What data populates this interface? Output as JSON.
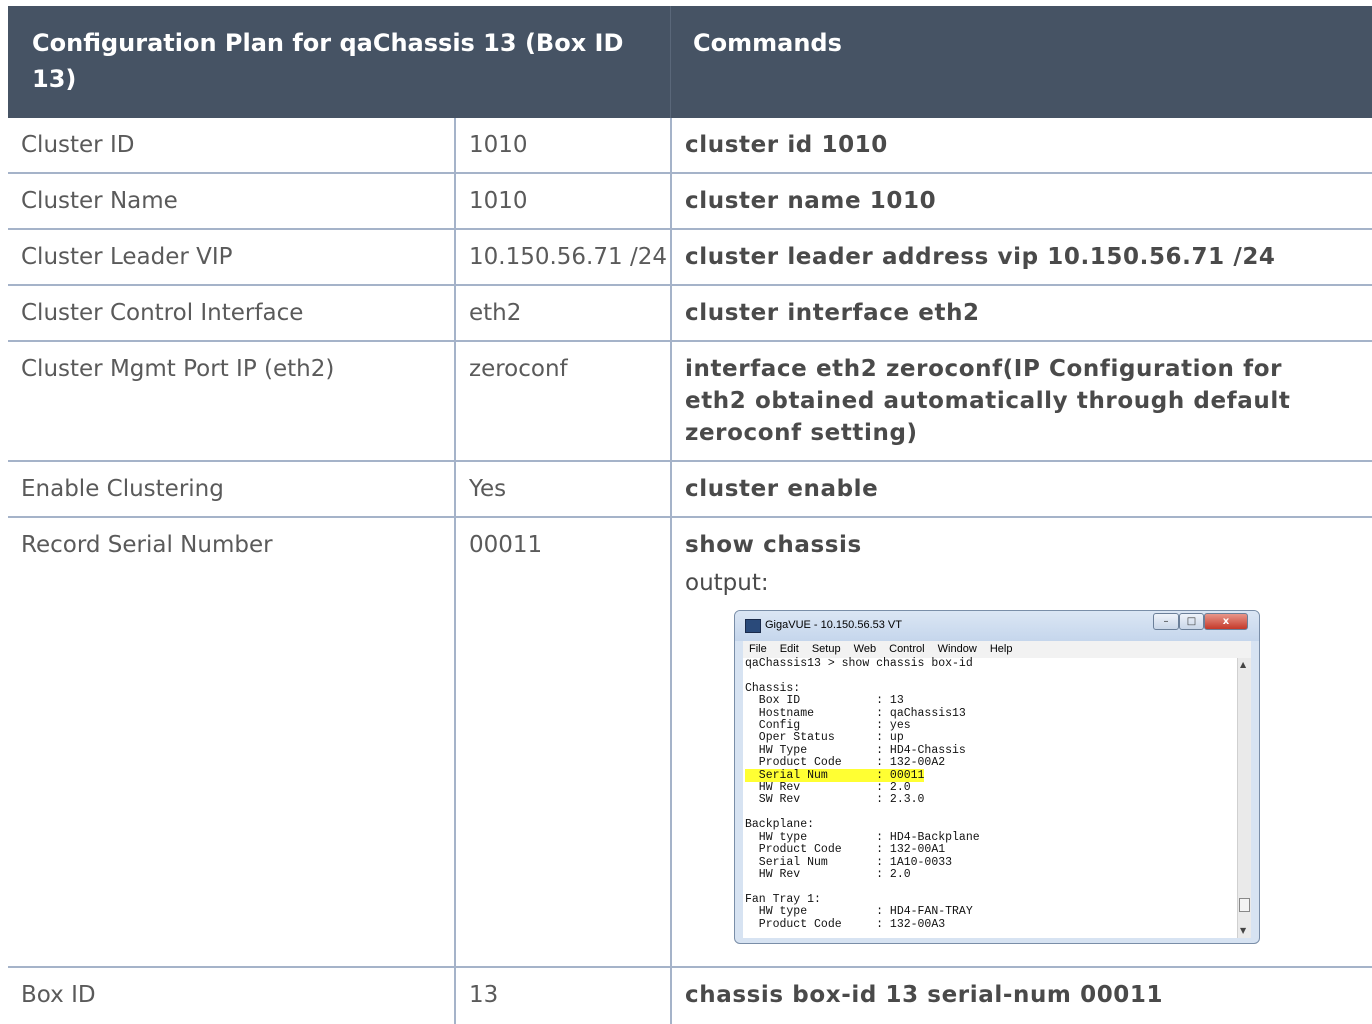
{
  "table": {
    "header": {
      "col1": "Configuration Plan for qaChassis 13 (Box ID 13)",
      "col2": "Commands"
    },
    "rows": [
      {
        "label": "Cluster ID",
        "value": "1010",
        "command": "cluster id 1010"
      },
      {
        "label": "Cluster Name",
        "value": "1010",
        "command": "cluster name 1010"
      },
      {
        "label": "Cluster Leader VIP",
        "value": "10.150.56.71 /24",
        "command": "cluster leader address vip 10.150.56.71 /24"
      },
      {
        "label": "Cluster Control Interface",
        "value": "eth2",
        "command": "cluster interface eth2"
      },
      {
        "label": "Cluster Mgmt Port IP (eth2)",
        "value": "zeroconf",
        "command": "interface eth2 zeroconf(IP Configuration for eth2 obtained automatically through default zeroconf setting)"
      },
      {
        "label": "Enable Clustering",
        "value": "Yes",
        "command": "cluster enable"
      },
      {
        "label": "Record Serial Number",
        "value": "00011",
        "command": "show chassis",
        "extra": "output:"
      },
      {
        "label": "Box ID",
        "value": "13",
        "command": "chassis box-id 13 serial-num 00011"
      }
    ]
  },
  "terminal": {
    "title": "GigaVUE - 10.150.56.53 VT",
    "menu": [
      "File",
      "Edit",
      "Setup",
      "Web",
      "Control",
      "Window",
      "Help"
    ],
    "lines": [
      "qaChassis13 > show chassis box-id",
      "",
      "Chassis:",
      "  Box ID           : 13",
      "  Hostname         : qaChassis13",
      "  Config           : yes",
      "  Oper Status      : up",
      "  HW Type          : HD4-Chassis",
      "  Product Code     : 132-00A2",
      "  Serial Num       : 00011",
      "  HW Rev           : 2.0",
      "  SW Rev           : 2.3.0",
      "",
      "Backplane:",
      "  HW type          : HD4-Backplane",
      "  Product Code     : 132-00A1",
      "  Serial Num       : 1A10-0033",
      "  HW Rev           : 2.0",
      "",
      "Fan Tray 1:",
      "  HW type          : HD4-FAN-TRAY",
      "  Product Code     : 132-00A3"
    ],
    "highlight_line": 9,
    "highlight_color": "#ffff33"
  },
  "colors": {
    "header_bg": "#465364",
    "border": "#a5b3c9"
  }
}
